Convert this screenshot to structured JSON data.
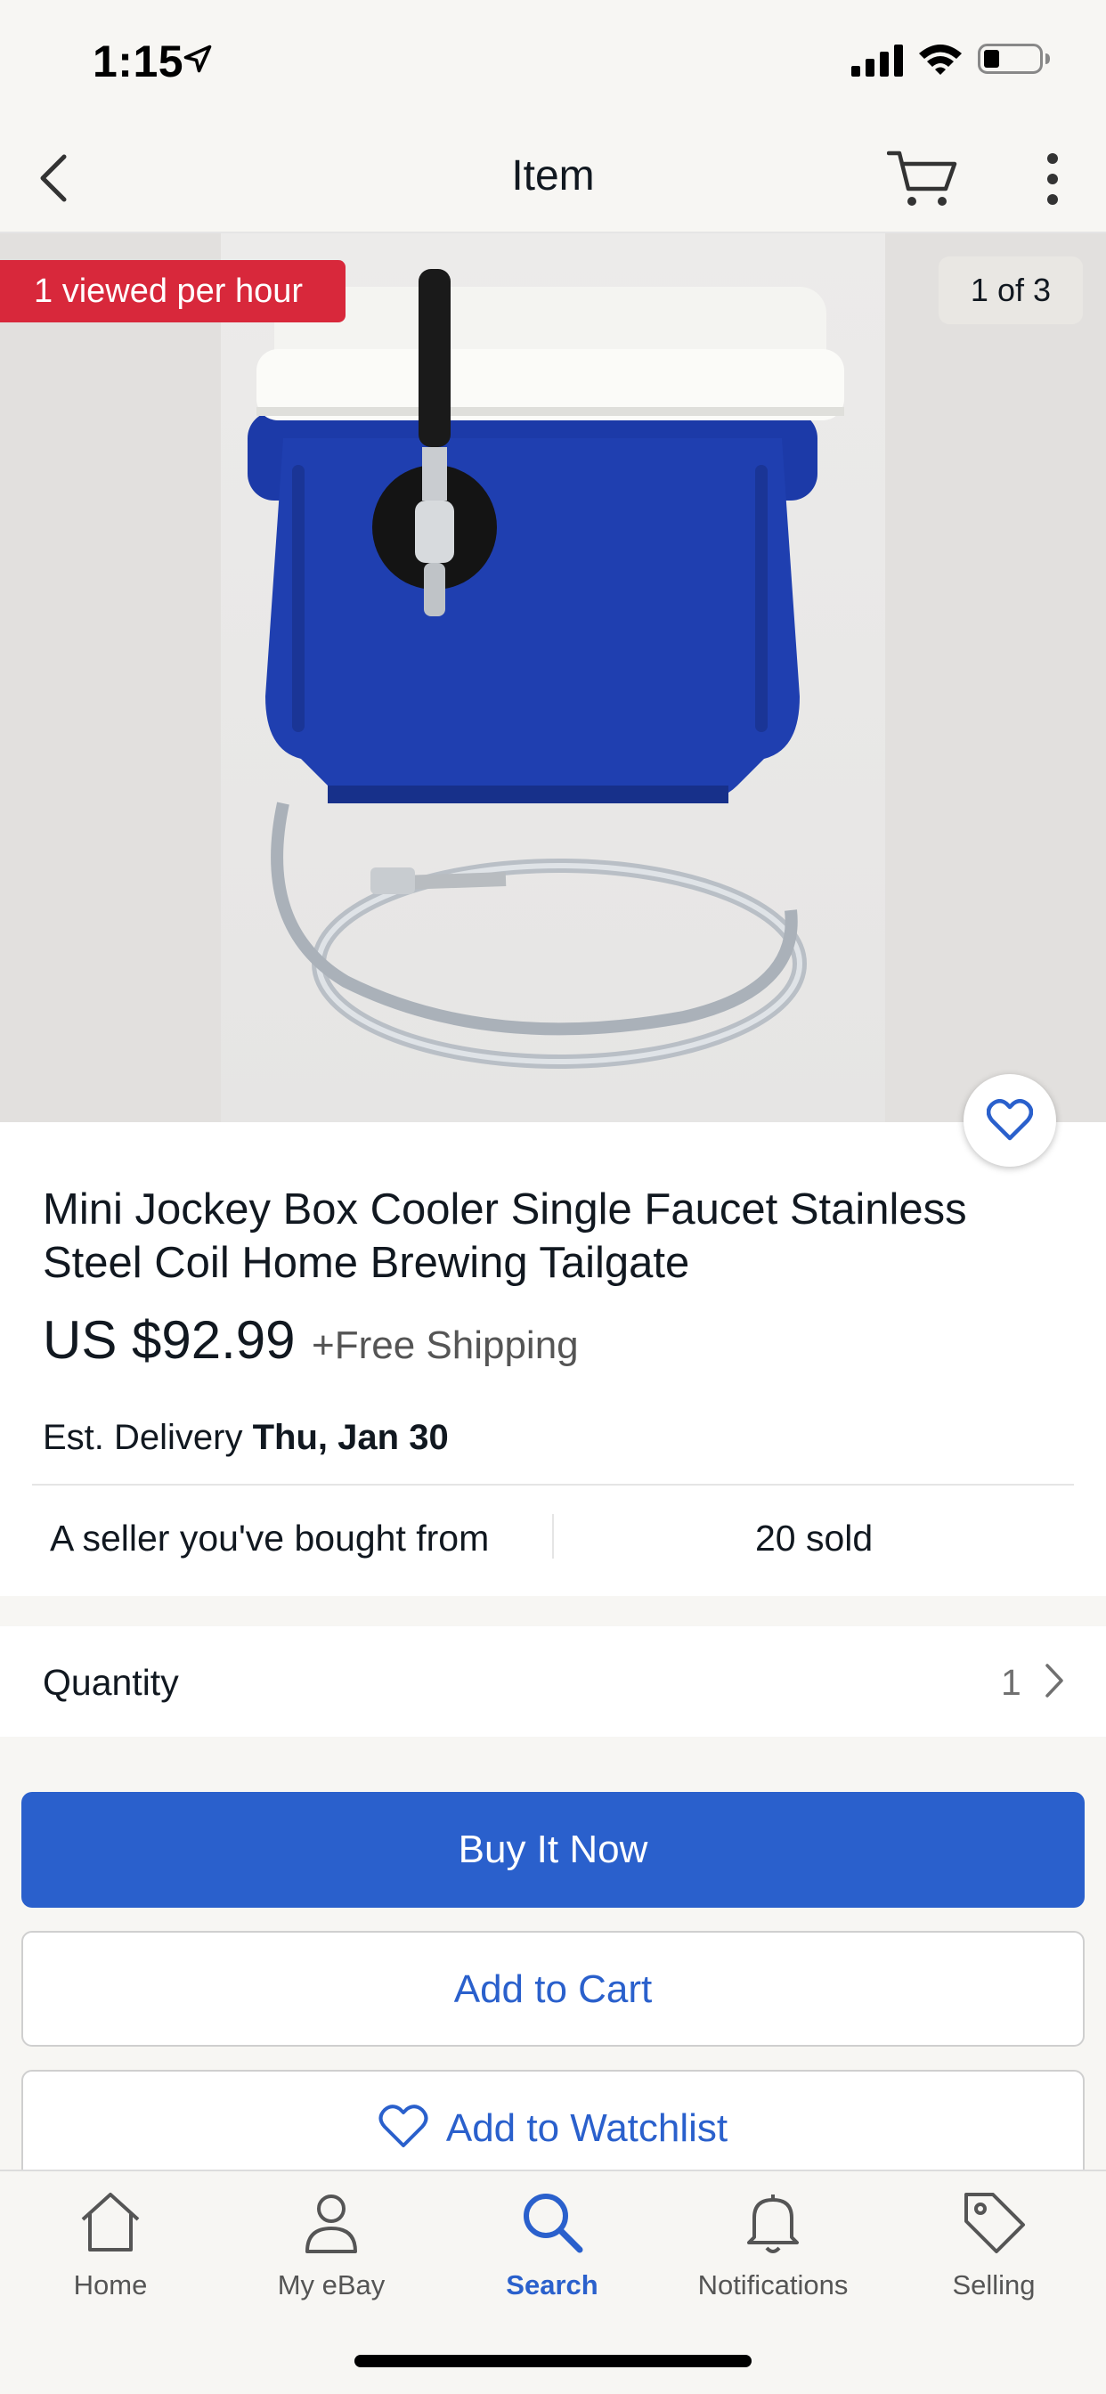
{
  "status_bar": {
    "time": "1:15",
    "icons": [
      "location-arrow-icon",
      "cellular-signal-icon",
      "wifi-icon",
      "battery-icon"
    ]
  },
  "nav": {
    "title": "Item",
    "icons": [
      "back-chevron-icon",
      "cart-icon",
      "more-vertical-icon"
    ]
  },
  "gallery": {
    "viewed_badge": "1 viewed per hour",
    "counter": "1 of 3",
    "favorite_icon": "heart-icon"
  },
  "item": {
    "title": "Mini Jockey Box Cooler Single Faucet Stainless Steel Coil Home Brewing Tailgate",
    "price": "US $92.99",
    "shipping": "+Free Shipping",
    "delivery_prefix": "Est. Delivery",
    "delivery_date": "Thu, Jan 30",
    "seller_info": "A seller you've bought from",
    "sold": "20 sold"
  },
  "quantity": {
    "label": "Quantity",
    "value": "1"
  },
  "actions": {
    "buy_now": "Buy It Now",
    "add_to_cart": "Add to Cart",
    "add_to_watchlist": "Add to Watchlist"
  },
  "tabs": [
    {
      "label": "Home",
      "icon": "home-icon",
      "active": false
    },
    {
      "label": "My eBay",
      "icon": "person-icon",
      "active": false
    },
    {
      "label": "Search",
      "icon": "search-icon",
      "active": true
    },
    {
      "label": "Notifications",
      "icon": "bell-icon",
      "active": false
    },
    {
      "label": "Selling",
      "icon": "tag-icon",
      "active": false
    }
  ],
  "colors": {
    "accent": "#2a60cc",
    "badge_red": "#d8283b",
    "cooler_blue": "#1f3fb0",
    "background_gray": "#f7f6f3"
  }
}
